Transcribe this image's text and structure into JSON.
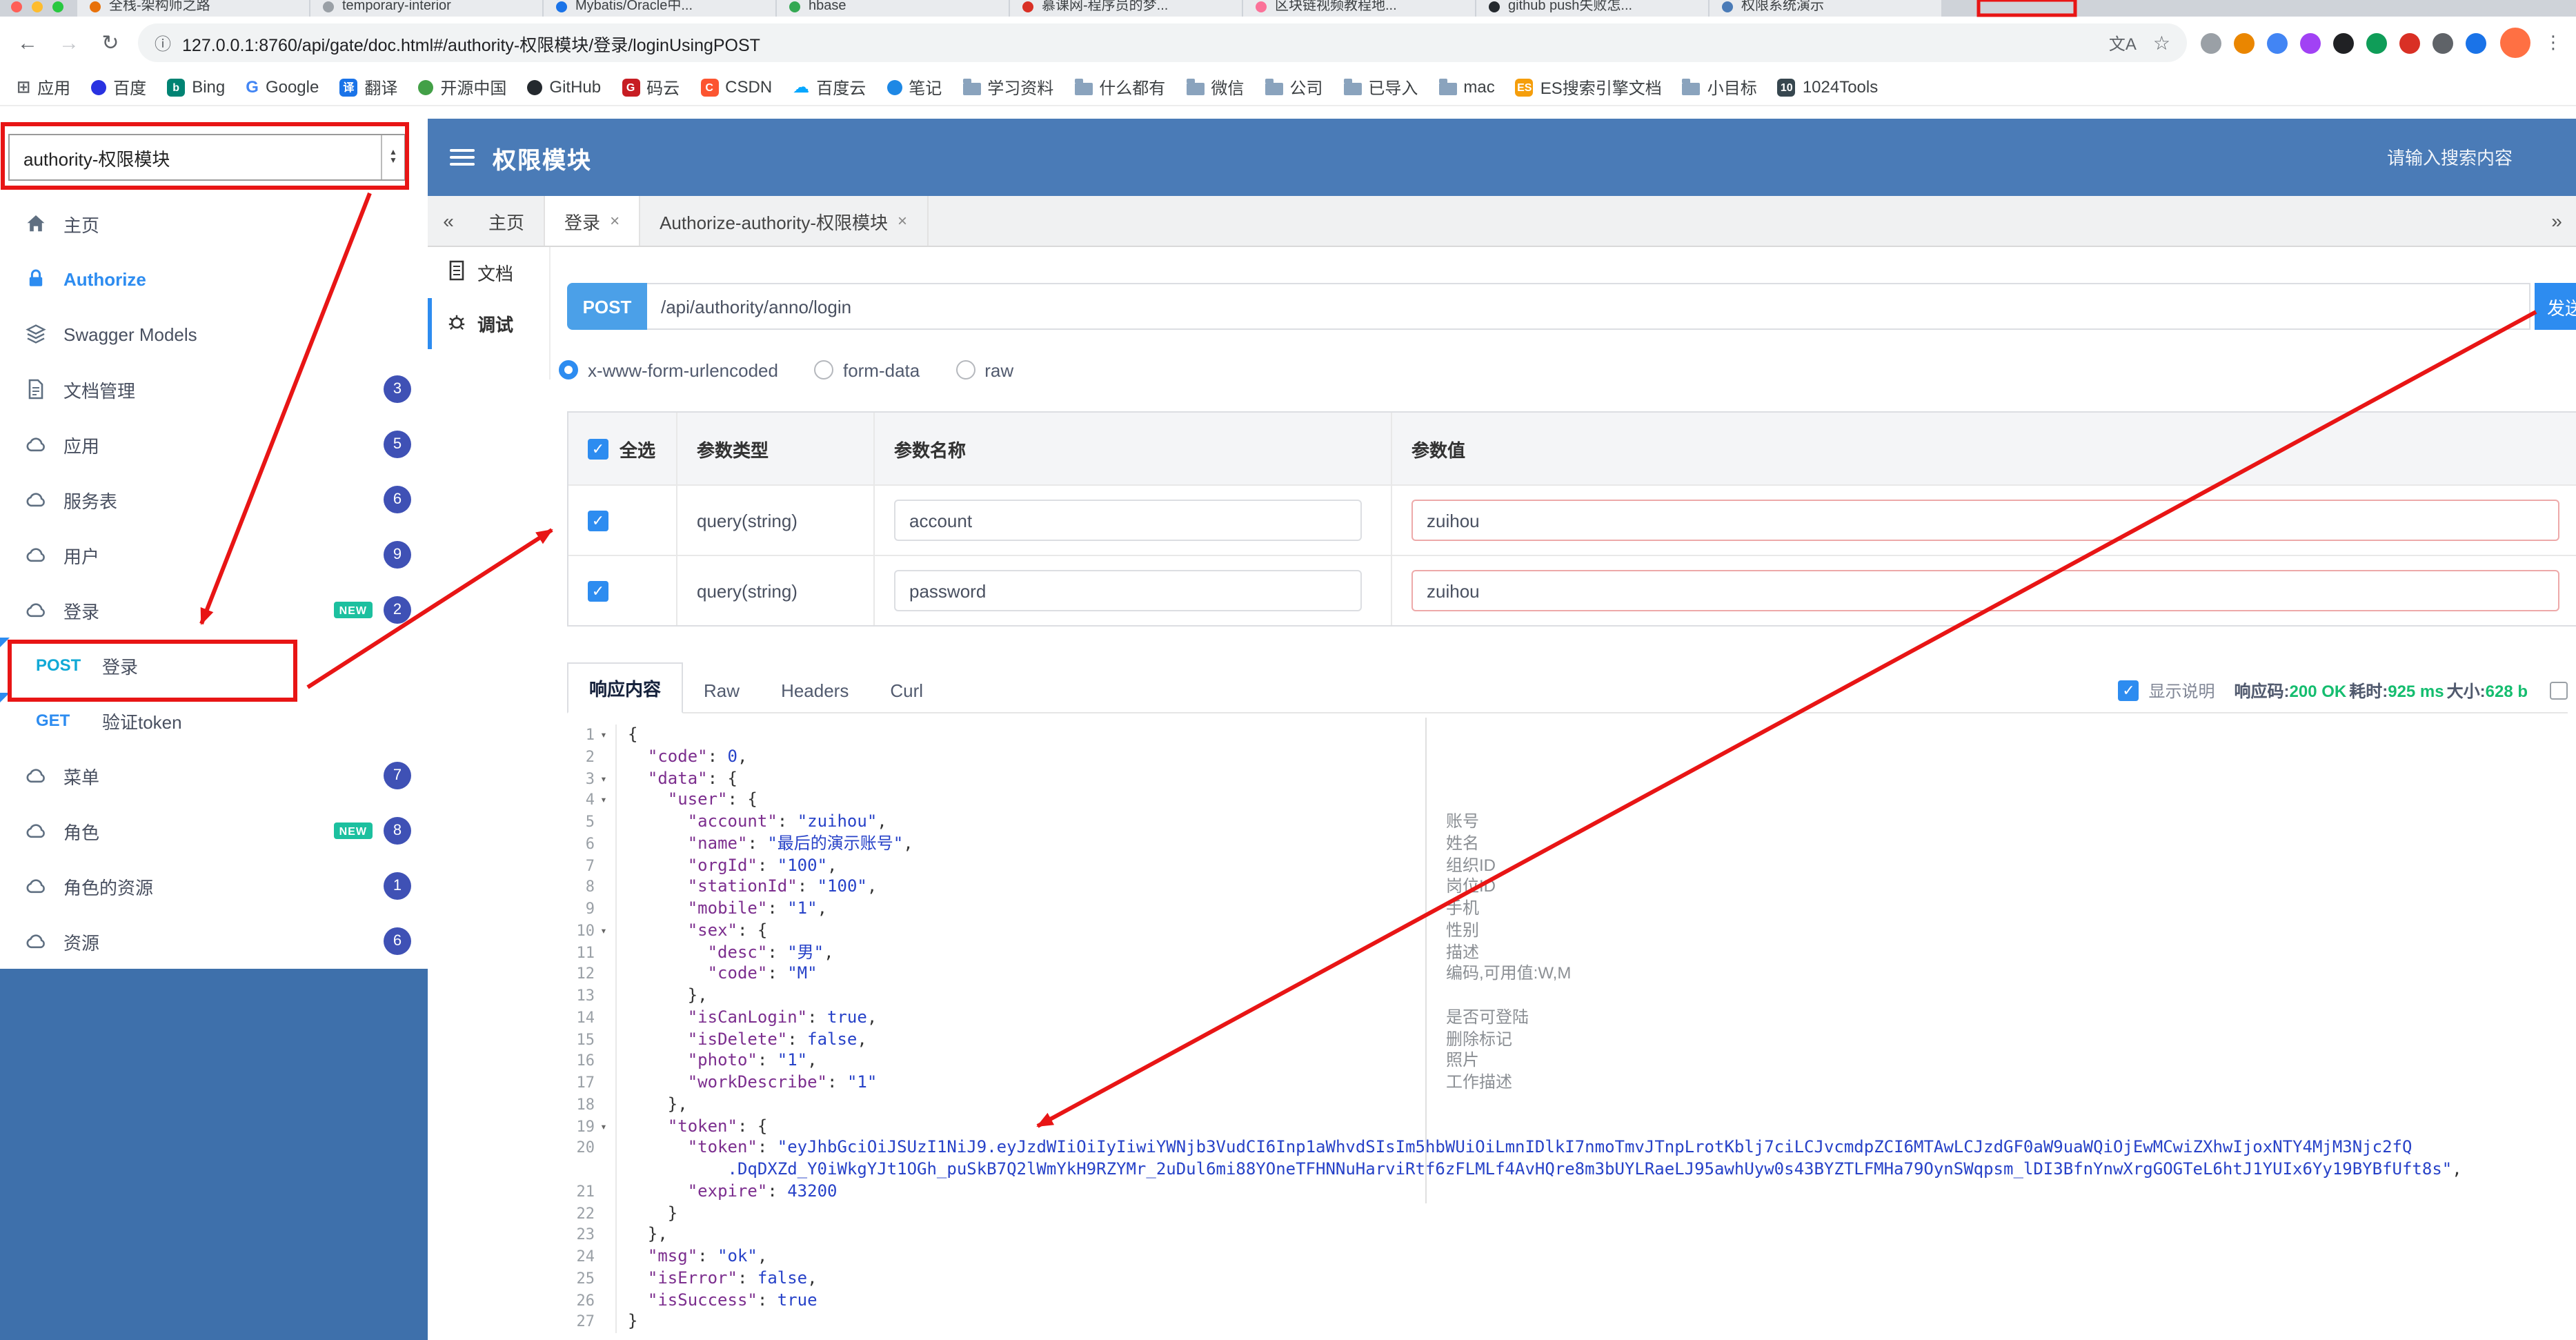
{
  "browser": {
    "tabs": [
      {
        "title": "全栈-架构师之路",
        "color": "#e8710a"
      },
      {
        "title": "temporary-interior",
        "color": "#9aa0a6"
      },
      {
        "title": "Mybatis/Oracle中...",
        "color": "#1a73e8"
      },
      {
        "title": "hbase",
        "color": "#34a853"
      },
      {
        "title": "慕课网-程序员的梦...",
        "color": "#d93025"
      },
      {
        "title": "区块链视频教程地...",
        "color": "#fb7299"
      },
      {
        "title": "github push失败怎...",
        "color": "#24292e"
      },
      {
        "title": "权限系统演示",
        "color": "#4a7bb7"
      }
    ],
    "nav": {
      "back": "←",
      "forward": "→",
      "reload": "↻"
    },
    "url": "127.0.0.1:8760/api/gate/doc.html#/authority-权限模块/登录/loginUsingPOST",
    "info_glyph": "ⓘ",
    "translate_glyph": "文A",
    "star_glyph": "☆",
    "extensions": [
      "#9aa0a6",
      "#ea8600",
      "#4285f4",
      "#a142f4",
      "#202124",
      "#0f9d58",
      "#d93025",
      "#5f6368",
      "#1a73e8"
    ],
    "avatar_color": "#ff7043",
    "bookmarks": [
      {
        "label": "应用",
        "type": "glyph",
        "char": "⊞",
        "color": "#5f6368"
      },
      {
        "label": "百度",
        "type": "dot",
        "color": "#2932e1"
      },
      {
        "label": "Bing",
        "type": "badge",
        "char": "b",
        "color": "#008373"
      },
      {
        "label": "Google",
        "type": "glyph",
        "char": "G",
        "color": "#4285f4"
      },
      {
        "label": "翻译",
        "type": "badge",
        "char": "译",
        "color": "#1a73e8"
      },
      {
        "label": "开源中国",
        "type": "dot",
        "color": "#43a047"
      },
      {
        "label": "GitHub",
        "type": "dot",
        "color": "#24292e"
      },
      {
        "label": "码云",
        "type": "badge",
        "char": "G",
        "color": "#c71d23"
      },
      {
        "label": "CSDN",
        "type": "badge",
        "char": "C",
        "color": "#fc5531"
      },
      {
        "label": "百度云",
        "type": "glyph",
        "char": "☁",
        "color": "#06a7ff"
      },
      {
        "label": "笔记",
        "type": "dot",
        "color": "#1e88e5"
      },
      {
        "label": "学习资料",
        "type": "folder"
      },
      {
        "label": "什么都有",
        "type": "folder"
      },
      {
        "label": "微信",
        "type": "folder"
      },
      {
        "label": "公司",
        "type": "folder"
      },
      {
        "label": "已导入",
        "type": "folder"
      },
      {
        "label": "mac",
        "type": "folder"
      },
      {
        "label": "ES搜索引擎文档",
        "type": "badge",
        "char": "ES",
        "color": "#f59e0b"
      },
      {
        "label": "小目标",
        "type": "folder"
      },
      {
        "label": "1024Tools",
        "type": "badge",
        "char": "10",
        "color": "#37474f"
      }
    ]
  },
  "app": {
    "project_select": {
      "value": "authority-权限模块"
    },
    "header": {
      "title": "权限模块",
      "search_placeholder": "请输入搜索内容"
    },
    "sidebar": {
      "items": [
        {
          "id": "home",
          "label": "主页",
          "icon": "home-icon"
        },
        {
          "id": "authorize",
          "label": "Authorize",
          "icon": "lock-icon",
          "style": "auth"
        },
        {
          "id": "swagger-models",
          "label": "Swagger Models",
          "icon": "models-icon"
        },
        {
          "id": "doc-manage",
          "label": "文档管理",
          "icon": "doc-icon",
          "badge": "3"
        },
        {
          "id": "application",
          "label": "应用",
          "icon": "cloud-icon",
          "badge": "5"
        },
        {
          "id": "service",
          "label": "服务表",
          "icon": "cloud-icon",
          "badge": "6"
        },
        {
          "id": "user",
          "label": "用户",
          "icon": "cloud-icon",
          "badge": "9"
        },
        {
          "id": "login",
          "label": "登录",
          "icon": "cloud-icon",
          "badge": "2",
          "isNew": true
        },
        {
          "id": "op-login",
          "method": "POST",
          "label": "登录"
        },
        {
          "id": "op-verify-token",
          "method": "GET",
          "label": "验证token"
        },
        {
          "id": "menu",
          "label": "菜单",
          "icon": "cloud-icon",
          "badge": "7"
        },
        {
          "id": "role",
          "label": "角色",
          "icon": "cloud-icon",
          "badge": "8",
          "isNew": true
        },
        {
          "id": "role-resource",
          "label": "角色的资源",
          "icon": "cloud-icon",
          "badge": "1"
        },
        {
          "id": "resource",
          "label": "资源",
          "icon": "cloud-icon",
          "badge": "6"
        }
      ]
    },
    "content_tabs": {
      "collapse": "«",
      "expand": "»",
      "tabs": [
        {
          "label": "主页",
          "closable": false,
          "active": false
        },
        {
          "label": "登录",
          "closable": true,
          "active": true
        },
        {
          "label": "Authorize-authority-权限模块",
          "closable": true,
          "active": false
        }
      ]
    },
    "doc_nav": [
      {
        "label": "文档",
        "icon": "doc-nav-icon",
        "active": false
      },
      {
        "label": "调试",
        "icon": "debug-icon",
        "active": true
      }
    ],
    "debug": {
      "method": "POST",
      "path": "/api/authority/anno/login",
      "send_label": "发送",
      "content_types": {
        "options": [
          "x-www-form-urlencoded",
          "form-data",
          "raw"
        ],
        "selected": "x-www-form-urlencoded"
      },
      "params_table": {
        "headers": [
          "全选",
          "参数类型",
          "参数名称",
          "参数值"
        ],
        "rows": [
          {
            "checked": true,
            "type": "query(string)",
            "name": "account",
            "value": "zuihou"
          },
          {
            "checked": true,
            "type": "query(string)",
            "name": "password",
            "value": "zuihou"
          }
        ]
      }
    },
    "response": {
      "tabs": [
        {
          "label": "响应内容",
          "active": true
        },
        {
          "label": "Raw",
          "active": false
        },
        {
          "label": "Headers",
          "active": false
        },
        {
          "label": "Curl",
          "active": false
        }
      ],
      "show_desc": {
        "label": "显示说明",
        "checked": true
      },
      "meta": [
        {
          "label": "响应码:",
          "value": "200 OK"
        },
        {
          "label": "耗时:",
          "value": "925 ms"
        },
        {
          "label": "大小:",
          "value": "628 b"
        }
      ],
      "code": {
        "lines": [
          {
            "n": 1,
            "fold": true,
            "seg": [
              [
                "p",
                "{"
              ]
            ]
          },
          {
            "n": 2,
            "seg": [
              [
                "p",
                "  "
              ],
              [
                "k",
                "\"code\""
              ],
              [
                "p",
                ": "
              ],
              [
                "v",
                "0"
              ],
              [
                "p",
                ","
              ]
            ]
          },
          {
            "n": 3,
            "fold": true,
            "seg": [
              [
                "p",
                "  "
              ],
              [
                "k",
                "\"data\""
              ],
              [
                "p",
                ": {"
              ]
            ]
          },
          {
            "n": 4,
            "fold": true,
            "seg": [
              [
                "p",
                "    "
              ],
              [
                "k",
                "\"user\""
              ],
              [
                "p",
                ": {"
              ]
            ]
          },
          {
            "n": 5,
            "seg": [
              [
                "p",
                "      "
              ],
              [
                "k",
                "\"account\""
              ],
              [
                "p",
                ": "
              ],
              [
                "v",
                "\"zuihou\""
              ],
              [
                "p",
                ","
              ]
            ]
          },
          {
            "n": 6,
            "seg": [
              [
                "p",
                "      "
              ],
              [
                "k",
                "\"name\""
              ],
              [
                "p",
                ": "
              ],
              [
                "v",
                "\"最后的演示账号\""
              ],
              [
                "p",
                ","
              ]
            ]
          },
          {
            "n": 7,
            "seg": [
              [
                "p",
                "      "
              ],
              [
                "k",
                "\"orgId\""
              ],
              [
                "p",
                ": "
              ],
              [
                "v",
                "\"100\""
              ],
              [
                "p",
                ","
              ]
            ]
          },
          {
            "n": 8,
            "seg": [
              [
                "p",
                "      "
              ],
              [
                "k",
                "\"stationId\""
              ],
              [
                "p",
                ": "
              ],
              [
                "v",
                "\"100\""
              ],
              [
                "p",
                ","
              ]
            ]
          },
          {
            "n": 9,
            "seg": [
              [
                "p",
                "      "
              ],
              [
                "k",
                "\"mobile\""
              ],
              [
                "p",
                ": "
              ],
              [
                "v",
                "\"1\""
              ],
              [
                "p",
                ","
              ]
            ]
          },
          {
            "n": 10,
            "fold": true,
            "seg": [
              [
                "p",
                "      "
              ],
              [
                "k",
                "\"sex\""
              ],
              [
                "p",
                ": {"
              ]
            ]
          },
          {
            "n": 11,
            "seg": [
              [
                "p",
                "        "
              ],
              [
                "k",
                "\"desc\""
              ],
              [
                "p",
                ": "
              ],
              [
                "v",
                "\"男\""
              ],
              [
                "p",
                ","
              ]
            ]
          },
          {
            "n": 12,
            "seg": [
              [
                "p",
                "        "
              ],
              [
                "k",
                "\"code\""
              ],
              [
                "p",
                ": "
              ],
              [
                "v",
                "\"M\""
              ]
            ]
          },
          {
            "n": 13,
            "seg": [
              [
                "p",
                "      },"
              ]
            ]
          },
          {
            "n": 14,
            "seg": [
              [
                "p",
                "      "
              ],
              [
                "k",
                "\"isCanLogin\""
              ],
              [
                "p",
                ": "
              ],
              [
                "v",
                "true"
              ],
              [
                "p",
                ","
              ]
            ]
          },
          {
            "n": 15,
            "seg": [
              [
                "p",
                "      "
              ],
              [
                "k",
                "\"isDelete\""
              ],
              [
                "p",
                ": "
              ],
              [
                "v",
                "false"
              ],
              [
                "p",
                ","
              ]
            ]
          },
          {
            "n": 16,
            "seg": [
              [
                "p",
                "      "
              ],
              [
                "k",
                "\"photo\""
              ],
              [
                "p",
                ": "
              ],
              [
                "v",
                "\"1\""
              ],
              [
                "p",
                ","
              ]
            ]
          },
          {
            "n": 17,
            "seg": [
              [
                "p",
                "      "
              ],
              [
                "k",
                "\"workDescribe\""
              ],
              [
                "p",
                ": "
              ],
              [
                "v",
                "\"1\""
              ]
            ]
          },
          {
            "n": 18,
            "seg": [
              [
                "p",
                "    },"
              ]
            ]
          },
          {
            "n": 19,
            "fold": true,
            "seg": [
              [
                "p",
                "    "
              ],
              [
                "k",
                "\"token\""
              ],
              [
                "p",
                ": {"
              ]
            ]
          },
          {
            "n": 20,
            "seg": [
              [
                "p",
                "      "
              ],
              [
                "k",
                "\"token\""
              ],
              [
                "p",
                ": "
              ],
              [
                "v",
                "\"eyJhbGciOiJSUzI1NiJ9.eyJzdWIiOiIyIiwiYWNjb3VudCI6Inp1aWhvdSIsIm5hbWUiOiLmnIDlkI7nmoTmvJTnpLrotKblj7ciLCJvcmdpZCI6MTAwLCJzdGF0aW9uaWQiOjEwMCwiZXhwIjoxNTY4MjM3Njc2fQ"
              ]
            ]
          },
          {
            "n": null,
            "seg": [
              [
                "p",
                "          "
              ],
              [
                "v",
                ".DqDXZd_Y0iWkgYJt1OGh_puSkB7Q2lWmYkH9RZYMr_2uDul6mi88YOneTFHNNuHarviRtf6zFLMLf4AvHQre8m3bUYLRaeLJ95awhUyw0s43BYZTLFMHa79OynSWqpsm_lDI3BfnYnwXrgGOGTeL6htJ1YUIx6Yy19BYBfUft8s\""
              ],
              [
                "p",
                ","
              ]
            ]
          },
          {
            "n": 21,
            "seg": [
              [
                "p",
                "      "
              ],
              [
                "k",
                "\"expire\""
              ],
              [
                "p",
                ": "
              ],
              [
                "v",
                "43200"
              ]
            ]
          },
          {
            "n": 22,
            "seg": [
              [
                "p",
                "    }"
              ]
            ]
          },
          {
            "n": 23,
            "seg": [
              [
                "p",
                "  },"
              ]
            ]
          },
          {
            "n": 24,
            "seg": [
              [
                "p",
                "  "
              ],
              [
                "k",
                "\"msg\""
              ],
              [
                "p",
                ": "
              ],
              [
                "v",
                "\"ok\""
              ],
              [
                "p",
                ","
              ]
            ]
          },
          {
            "n": 25,
            "seg": [
              [
                "p",
                "  "
              ],
              [
                "k",
                "\"isError\""
              ],
              [
                "p",
                ": "
              ],
              [
                "v",
                "false"
              ],
              [
                "p",
                ","
              ]
            ]
          },
          {
            "n": 26,
            "seg": [
              [
                "p",
                "  "
              ],
              [
                "k",
                "\"isSuccess\""
              ],
              [
                "p",
                ": "
              ],
              [
                "v",
                "true"
              ]
            ]
          },
          {
            "n": 27,
            "seg": [
              [
                "p",
                "}"
              ]
            ]
          }
        ]
      },
      "annotations": [
        {
          "row": 4,
          "text": "账号"
        },
        {
          "row": 5,
          "text": "姓名"
        },
        {
          "row": 6,
          "text": "组织ID"
        },
        {
          "row": 7,
          "text": "岗位ID"
        },
        {
          "row": 8,
          "text": "手机"
        },
        {
          "row": 9,
          "text": "性别"
        },
        {
          "row": 10,
          "text": "描述"
        },
        {
          "row": 11,
          "text": "编码,可用值:W,M"
        },
        {
          "row": 13,
          "text": "是否可登陆"
        },
        {
          "row": 14,
          "text": "删除标记"
        },
        {
          "row": 15,
          "text": "照片"
        },
        {
          "row": 16,
          "text": "工作描述"
        }
      ]
    }
  }
}
